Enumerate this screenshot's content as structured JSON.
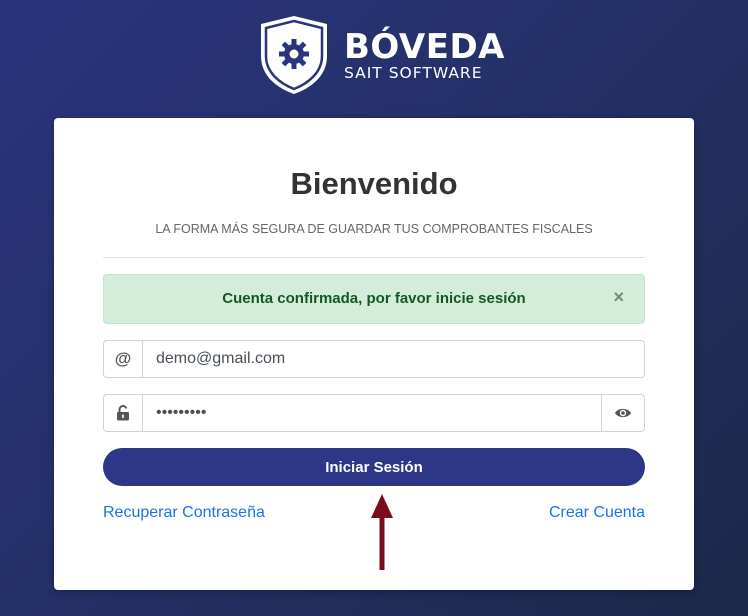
{
  "brand": {
    "name": "BÓVEDA",
    "tagline": "SAIT SOFTWARE"
  },
  "login": {
    "title": "Bienvenido",
    "subtitle": "LA FORMA MÁS SEGURA DE GUARDAR TUS COMPROBANTES FISCALES",
    "alert": {
      "message": "Cuenta confirmada, por favor inicie sesión",
      "close_label": "×"
    },
    "email": {
      "prefix": "@",
      "value": "demo@gmail.com"
    },
    "password": {
      "value": "•••••••••"
    },
    "submit_label": "Iniciar Sesión",
    "recover_label": "Recuperar Contraseña",
    "create_label": "Crear Cuenta"
  },
  "icons": {
    "logo": "shield-gear-icon",
    "email_prefix": "at-icon",
    "password_prefix": "unlock-icon",
    "password_toggle": "eye-icon",
    "annotation": "up-arrow-icon"
  },
  "colors": {
    "primary": "#2d3687",
    "alert_bg": "#d4edda",
    "alert_text": "#155724",
    "link": "#1a73e8",
    "annotation_arrow": "#7a0c1e"
  }
}
